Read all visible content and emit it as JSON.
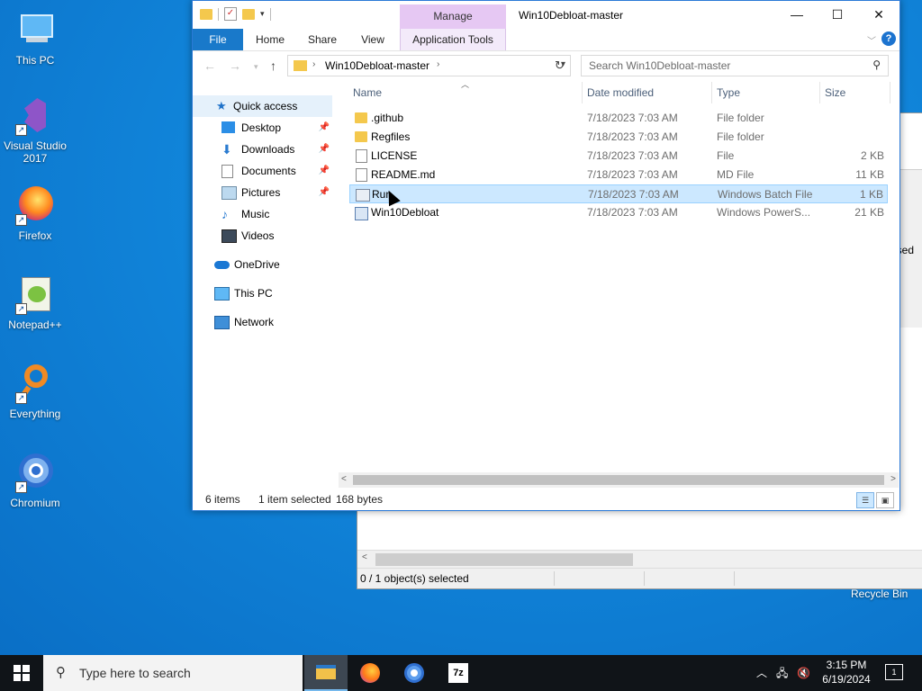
{
  "desktop": {
    "icons": [
      {
        "label": "This PC"
      },
      {
        "label": "Visual Studio 2017"
      },
      {
        "label": "Firefox"
      },
      {
        "label": "Notepad++"
      },
      {
        "label": "Everything"
      },
      {
        "label": "Chromium"
      }
    ],
    "recycle_bin": "Recycle Bin"
  },
  "background_window": {
    "partial_text": "sed",
    "status": "0 / 1 object(s) selected"
  },
  "explorer": {
    "title": "Win10Debloat-master",
    "manage_tab": "Manage",
    "ribbon_tabs": [
      "File",
      "Home",
      "Share",
      "View",
      "Application Tools"
    ],
    "help": "?",
    "address_path": "Win10Debloat-master",
    "search_placeholder": "Search Win10Debloat-master",
    "nav": {
      "quick_access": "Quick access",
      "items": [
        "Desktop",
        "Downloads",
        "Documents",
        "Pictures",
        "Music",
        "Videos"
      ],
      "onedrive": "OneDrive",
      "this_pc": "This PC",
      "network": "Network"
    },
    "columns": [
      "Name",
      "Date modified",
      "Type",
      "Size"
    ],
    "files": [
      {
        "name": ".github",
        "date": "7/18/2023 7:03 AM",
        "type": "File folder",
        "size": "",
        "icon": "folder-icon"
      },
      {
        "name": "Regfiles",
        "date": "7/18/2023 7:03 AM",
        "type": "File folder",
        "size": "",
        "icon": "folder-icon"
      },
      {
        "name": "LICENSE",
        "date": "7/18/2023 7:03 AM",
        "type": "File",
        "size": "2 KB",
        "icon": "file-icon"
      },
      {
        "name": "README.md",
        "date": "7/18/2023 7:03 AM",
        "type": "MD File",
        "size": "11 KB",
        "icon": "file-icon"
      },
      {
        "name": "Run",
        "date": "7/18/2023 7:03 AM",
        "type": "Windows Batch File",
        "size": "1 KB",
        "icon": "batch-file-icon"
      },
      {
        "name": "Win10Debloat",
        "date": "7/18/2023 7:03 AM",
        "type": "Windows PowerS...",
        "size": "21 KB",
        "icon": "powershell-file-icon"
      }
    ],
    "selected_index": 4,
    "status": {
      "items": "6 items",
      "selected": "1 item selected",
      "size": "168 bytes"
    }
  },
  "taskbar": {
    "search_placeholder": "Type here to search",
    "seven_zip": "7z",
    "time": "3:15 PM",
    "date": "6/19/2024",
    "notification_count": "1"
  }
}
